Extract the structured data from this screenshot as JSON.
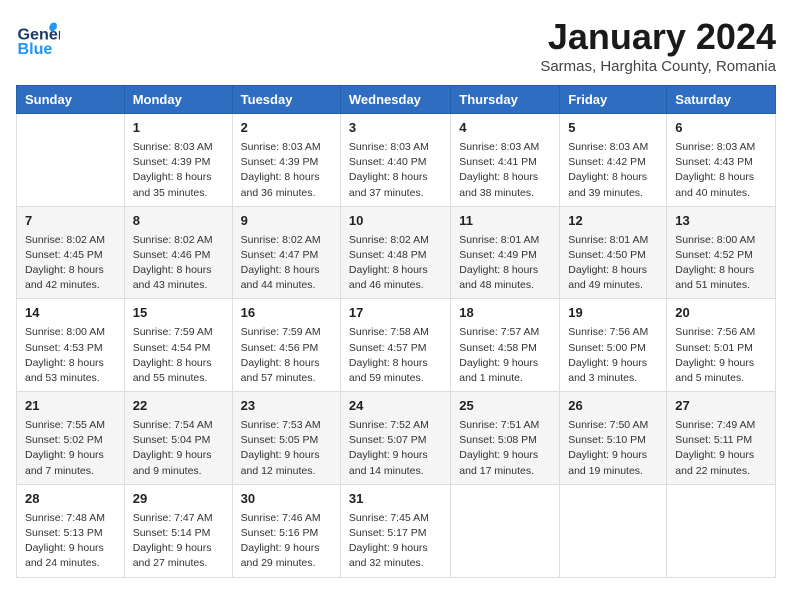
{
  "header": {
    "logo_general": "General",
    "logo_blue": "Blue",
    "title": "January 2024",
    "subtitle": "Sarmas, Harghita County, Romania"
  },
  "days_of_week": [
    "Sunday",
    "Monday",
    "Tuesday",
    "Wednesday",
    "Thursday",
    "Friday",
    "Saturday"
  ],
  "weeks": [
    [
      {
        "day": "",
        "info": ""
      },
      {
        "day": "1",
        "info": "Sunrise: 8:03 AM\nSunset: 4:39 PM\nDaylight: 8 hours\nand 35 minutes."
      },
      {
        "day": "2",
        "info": "Sunrise: 8:03 AM\nSunset: 4:39 PM\nDaylight: 8 hours\nand 36 minutes."
      },
      {
        "day": "3",
        "info": "Sunrise: 8:03 AM\nSunset: 4:40 PM\nDaylight: 8 hours\nand 37 minutes."
      },
      {
        "day": "4",
        "info": "Sunrise: 8:03 AM\nSunset: 4:41 PM\nDaylight: 8 hours\nand 38 minutes."
      },
      {
        "day": "5",
        "info": "Sunrise: 8:03 AM\nSunset: 4:42 PM\nDaylight: 8 hours\nand 39 minutes."
      },
      {
        "day": "6",
        "info": "Sunrise: 8:03 AM\nSunset: 4:43 PM\nDaylight: 8 hours\nand 40 minutes."
      }
    ],
    [
      {
        "day": "7",
        "info": "Sunrise: 8:02 AM\nSunset: 4:45 PM\nDaylight: 8 hours\nand 42 minutes."
      },
      {
        "day": "8",
        "info": "Sunrise: 8:02 AM\nSunset: 4:46 PM\nDaylight: 8 hours\nand 43 minutes."
      },
      {
        "day": "9",
        "info": "Sunrise: 8:02 AM\nSunset: 4:47 PM\nDaylight: 8 hours\nand 44 minutes."
      },
      {
        "day": "10",
        "info": "Sunrise: 8:02 AM\nSunset: 4:48 PM\nDaylight: 8 hours\nand 46 minutes."
      },
      {
        "day": "11",
        "info": "Sunrise: 8:01 AM\nSunset: 4:49 PM\nDaylight: 8 hours\nand 48 minutes."
      },
      {
        "day": "12",
        "info": "Sunrise: 8:01 AM\nSunset: 4:50 PM\nDaylight: 8 hours\nand 49 minutes."
      },
      {
        "day": "13",
        "info": "Sunrise: 8:00 AM\nSunset: 4:52 PM\nDaylight: 8 hours\nand 51 minutes."
      }
    ],
    [
      {
        "day": "14",
        "info": "Sunrise: 8:00 AM\nSunset: 4:53 PM\nDaylight: 8 hours\nand 53 minutes."
      },
      {
        "day": "15",
        "info": "Sunrise: 7:59 AM\nSunset: 4:54 PM\nDaylight: 8 hours\nand 55 minutes."
      },
      {
        "day": "16",
        "info": "Sunrise: 7:59 AM\nSunset: 4:56 PM\nDaylight: 8 hours\nand 57 minutes."
      },
      {
        "day": "17",
        "info": "Sunrise: 7:58 AM\nSunset: 4:57 PM\nDaylight: 8 hours\nand 59 minutes."
      },
      {
        "day": "18",
        "info": "Sunrise: 7:57 AM\nSunset: 4:58 PM\nDaylight: 9 hours\nand 1 minute."
      },
      {
        "day": "19",
        "info": "Sunrise: 7:56 AM\nSunset: 5:00 PM\nDaylight: 9 hours\nand 3 minutes."
      },
      {
        "day": "20",
        "info": "Sunrise: 7:56 AM\nSunset: 5:01 PM\nDaylight: 9 hours\nand 5 minutes."
      }
    ],
    [
      {
        "day": "21",
        "info": "Sunrise: 7:55 AM\nSunset: 5:02 PM\nDaylight: 9 hours\nand 7 minutes."
      },
      {
        "day": "22",
        "info": "Sunrise: 7:54 AM\nSunset: 5:04 PM\nDaylight: 9 hours\nand 9 minutes."
      },
      {
        "day": "23",
        "info": "Sunrise: 7:53 AM\nSunset: 5:05 PM\nDaylight: 9 hours\nand 12 minutes."
      },
      {
        "day": "24",
        "info": "Sunrise: 7:52 AM\nSunset: 5:07 PM\nDaylight: 9 hours\nand 14 minutes."
      },
      {
        "day": "25",
        "info": "Sunrise: 7:51 AM\nSunset: 5:08 PM\nDaylight: 9 hours\nand 17 minutes."
      },
      {
        "day": "26",
        "info": "Sunrise: 7:50 AM\nSunset: 5:10 PM\nDaylight: 9 hours\nand 19 minutes."
      },
      {
        "day": "27",
        "info": "Sunrise: 7:49 AM\nSunset: 5:11 PM\nDaylight: 9 hours\nand 22 minutes."
      }
    ],
    [
      {
        "day": "28",
        "info": "Sunrise: 7:48 AM\nSunset: 5:13 PM\nDaylight: 9 hours\nand 24 minutes."
      },
      {
        "day": "29",
        "info": "Sunrise: 7:47 AM\nSunset: 5:14 PM\nDaylight: 9 hours\nand 27 minutes."
      },
      {
        "day": "30",
        "info": "Sunrise: 7:46 AM\nSunset: 5:16 PM\nDaylight: 9 hours\nand 29 minutes."
      },
      {
        "day": "31",
        "info": "Sunrise: 7:45 AM\nSunset: 5:17 PM\nDaylight: 9 hours\nand 32 minutes."
      },
      {
        "day": "",
        "info": ""
      },
      {
        "day": "",
        "info": ""
      },
      {
        "day": "",
        "info": ""
      }
    ]
  ]
}
